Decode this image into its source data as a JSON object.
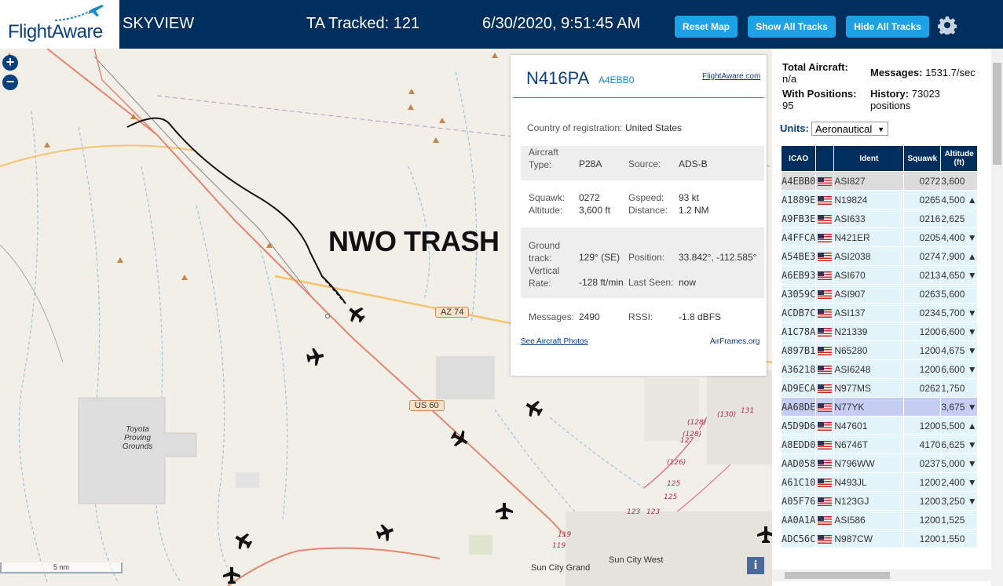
{
  "header": {
    "logo_text": "FlightAware",
    "title": "SKYVIEW",
    "tracked": "TA Tracked: 121",
    "clock": "6/30/2020, 9:51:45 AM",
    "buttons": {
      "reset": "Reset Map",
      "show": "Show All Tracks",
      "hide": "Hide All Tracks"
    },
    "colors": {
      "bar": "#002f5d",
      "button": "#1ea1e6"
    }
  },
  "map": {
    "zoom_in": "+",
    "zoom_out": "−",
    "watermark": "NWO TRASH",
    "road_labels": {
      "az74": "AZ 74",
      "us60": "US 60"
    },
    "places": {
      "toyota": "Toyota Proving Grounds",
      "suncity_grand": "Sun City Grand",
      "suncity_west": "Sun City West"
    },
    "scale": "5 nm",
    "info": "i",
    "mile_markers": [
      "(130)",
      "131",
      "(128)",
      "127",
      "(128)",
      "(126)",
      "125",
      "125",
      "123",
      "123",
      "119",
      "119"
    ]
  },
  "popup": {
    "registration": "N416PA",
    "hex": "A4EBB0",
    "link": "FlightAware.com",
    "country_label": "Country of registration:",
    "country": "United States",
    "aircraft_type_label": "Aircraft Type:",
    "aircraft_type": "P28A",
    "source_label": "Source:",
    "source": "ADS-B",
    "squawk_label": "Squawk:",
    "squawk": "0272",
    "gspeed_label": "Gspeed:",
    "gspeed": "93 kt",
    "altitude_label": "Altitude:",
    "altitude": "3,600 ft",
    "distance_label": "Distance:",
    "distance": "1.2 NM",
    "ground_track_label": "Ground track:",
    "ground_track": "129° (SE)",
    "position_label": "Position:",
    "position": "33.842°, -112.585°",
    "vrate_label": "Vertical Rate:",
    "vrate": "-128 ft/min",
    "last_seen_label": "Last Seen:",
    "last_seen": "now",
    "messages_label": "Messages:",
    "messages": "2490",
    "rssi_label": "RSSI:",
    "rssi": "-1.8 dBFS",
    "photos_link": "See Aircraft Photos",
    "airframes_link": "AirFrames.org"
  },
  "side": {
    "total_label": "Total Aircraft:",
    "total": "n/a",
    "messages_label": "Messages:",
    "messages": "1531.7/sec",
    "with_pos_label": "With Positions:",
    "with_pos": "95",
    "history_label": "History:",
    "history": "73023 positions",
    "units_label": "Units:",
    "units_value": "Aeronautical",
    "columns": {
      "icao": "ICAO",
      "ident": "Ident",
      "squawk": "Squawk",
      "altitude": "Altitude (ft)"
    },
    "rows": [
      {
        "icao": "A4EBB0",
        "ident": "ASI827",
        "squawk": "0272",
        "alt": "3,600",
        "trend": "",
        "state": "sel"
      },
      {
        "icao": "A1889E",
        "ident": "N19824",
        "squawk": "0265",
        "alt": "4,500",
        "trend": "▲",
        "state": ""
      },
      {
        "icao": "A9FB3E",
        "ident": "ASI633",
        "squawk": "0216",
        "alt": "2,625",
        "trend": "",
        "state": ""
      },
      {
        "icao": "A4FFCA",
        "ident": "N421ER",
        "squawk": "0205",
        "alt": "4,400",
        "trend": "▼",
        "state": ""
      },
      {
        "icao": "A54BE3",
        "ident": "ASI2038",
        "squawk": "0274",
        "alt": "7,900",
        "trend": "▲",
        "state": ""
      },
      {
        "icao": "A6EB93",
        "ident": "ASI670",
        "squawk": "0213",
        "alt": "4,650",
        "trend": "▼",
        "state": ""
      },
      {
        "icao": "A3059C",
        "ident": "ASI907",
        "squawk": "0263",
        "alt": "5,600",
        "trend": "",
        "state": ""
      },
      {
        "icao": "ACDB7C",
        "ident": "ASI137",
        "squawk": "0234",
        "alt": "5,700",
        "trend": "▼",
        "state": ""
      },
      {
        "icao": "A1C78A",
        "ident": "N21339",
        "squawk": "1200",
        "alt": "6,600",
        "trend": "▼",
        "state": ""
      },
      {
        "icao": "A897B1",
        "ident": "N65280",
        "squawk": "1200",
        "alt": "4,675",
        "trend": "▼",
        "state": ""
      },
      {
        "icao": "A36218",
        "ident": "ASI6248",
        "squawk": "1200",
        "alt": "6,600",
        "trend": "▼",
        "state": ""
      },
      {
        "icao": "AD9ECA",
        "ident": "N977MS",
        "squawk": "0262",
        "alt": "1,750",
        "trend": "",
        "state": ""
      },
      {
        "icao": "AA68DE",
        "ident": "N77YK",
        "squawk": "",
        "alt": "3,675",
        "trend": "▼",
        "state": "hl"
      },
      {
        "icao": "A5D9D6",
        "ident": "N47601",
        "squawk": "1200",
        "alt": "5,500",
        "trend": "▲",
        "state": ""
      },
      {
        "icao": "A8EDD0",
        "ident": "N6746T",
        "squawk": "4170",
        "alt": "6,625",
        "trend": "▼",
        "state": ""
      },
      {
        "icao": "AAD058",
        "ident": "N796WW",
        "squawk": "0237",
        "alt": "5,000",
        "trend": "▼",
        "state": ""
      },
      {
        "icao": "A61C10",
        "ident": "N493JL",
        "squawk": "1200",
        "alt": "2,400",
        "trend": "▼",
        "state": ""
      },
      {
        "icao": "A05F76",
        "ident": "N123GJ",
        "squawk": "1200",
        "alt": "3,250",
        "trend": "▼",
        "state": ""
      },
      {
        "icao": "AA0A1A",
        "ident": "ASI586",
        "squawk": "1200",
        "alt": "1,525",
        "trend": "",
        "state": ""
      },
      {
        "icao": "ADC56C",
        "ident": "N987CW",
        "squawk": "1200",
        "alt": "1,550",
        "trend": "",
        "state": ""
      }
    ]
  }
}
